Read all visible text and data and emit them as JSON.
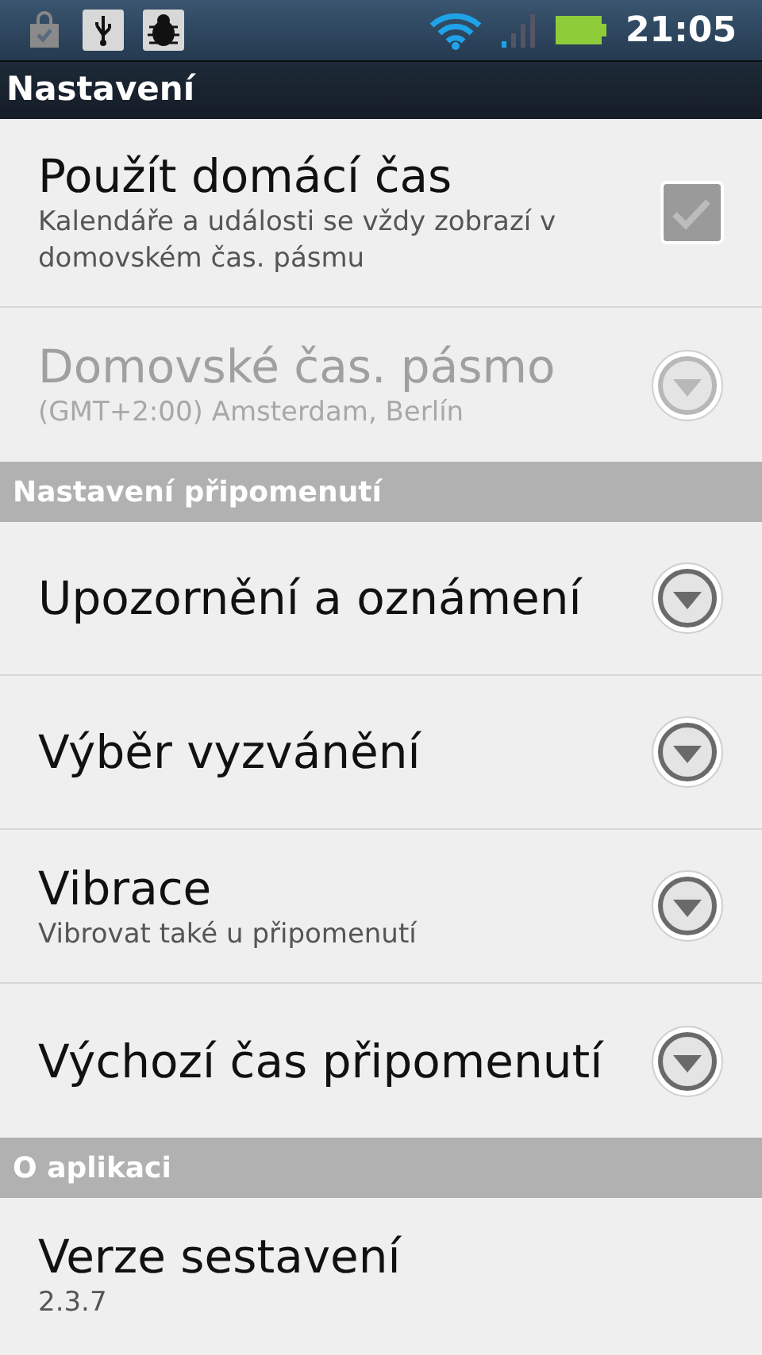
{
  "status_bar": {
    "time": "21:05"
  },
  "title_bar": {
    "title": "Nastavení"
  },
  "sections": [
    {
      "items": [
        {
          "kind": "checkbox",
          "title": "Použít domácí čas",
          "summary": "Kalendáře a události se vždy zobrazí v domovském čas. pásmu",
          "disabled": false,
          "checked": true
        },
        {
          "kind": "dropdown",
          "title": "Domovské čas. pásmo",
          "summary": "(GMT+2:00) Amsterdam, Berlín",
          "disabled": true
        }
      ]
    },
    {
      "title": "Nastavení připomenutí",
      "items": [
        {
          "kind": "dropdown",
          "title": "Upozornění a oznámení",
          "disabled": false
        },
        {
          "kind": "dropdown",
          "title": "Výběr vyzvánění",
          "disabled": false
        },
        {
          "kind": "dropdown",
          "title": "Vibrace",
          "summary": "Vibrovat také u připomenutí",
          "disabled": false
        },
        {
          "kind": "dropdown",
          "title": "Výchozí čas připomenutí",
          "disabled": false
        }
      ]
    },
    {
      "title": "O aplikaci",
      "items": [
        {
          "kind": "info",
          "title": "Verze sestavení",
          "summary": "2.3.7",
          "disabled": false
        }
      ]
    }
  ]
}
